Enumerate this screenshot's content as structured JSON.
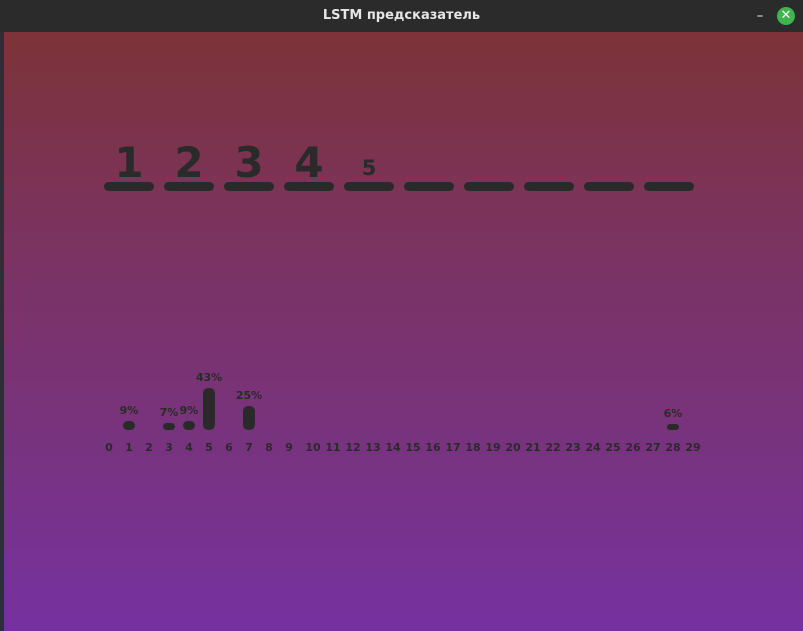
{
  "window": {
    "title": "LSTM предсказатель",
    "minimize_glyph": "–",
    "close_glyph": "✕",
    "close_color": "#3fb34f"
  },
  "sequence": {
    "entered_digits": [
      "1",
      "2",
      "3",
      "4"
    ],
    "predicted_digit": "5",
    "slot_count": 10
  },
  "chart_data": {
    "type": "bar",
    "categories": [
      "0",
      "1",
      "2",
      "3",
      "4",
      "5",
      "6",
      "7",
      "8",
      "9",
      "10",
      "11",
      "12",
      "13",
      "14",
      "15",
      "16",
      "17",
      "18",
      "19",
      "20",
      "21",
      "22",
      "23",
      "24",
      "25",
      "26",
      "27",
      "28",
      "29"
    ],
    "values": [
      0,
      9,
      0,
      7,
      9,
      43,
      0,
      25,
      0,
      0,
      0,
      0,
      0,
      0,
      0,
      0,
      0,
      0,
      0,
      0,
      0,
      0,
      0,
      0,
      0,
      0,
      0,
      0,
      6,
      0
    ],
    "data_labels": [
      "",
      "9%",
      "",
      "7%",
      "9%",
      "43%",
      "",
      "25%",
      "",
      "",
      "",
      "",
      "",
      "",
      "",
      "",
      "",
      "",
      "",
      "",
      "",
      "",
      "",
      "",
      "",
      "",
      "",
      "",
      "6%",
      ""
    ],
    "unit": "%",
    "xlabel": "",
    "ylabel": "",
    "grid": false
  },
  "colors": {
    "ink": "#2a2a2a",
    "bg_top": "#7d3338",
    "bg_bottom": "#7631a0"
  }
}
